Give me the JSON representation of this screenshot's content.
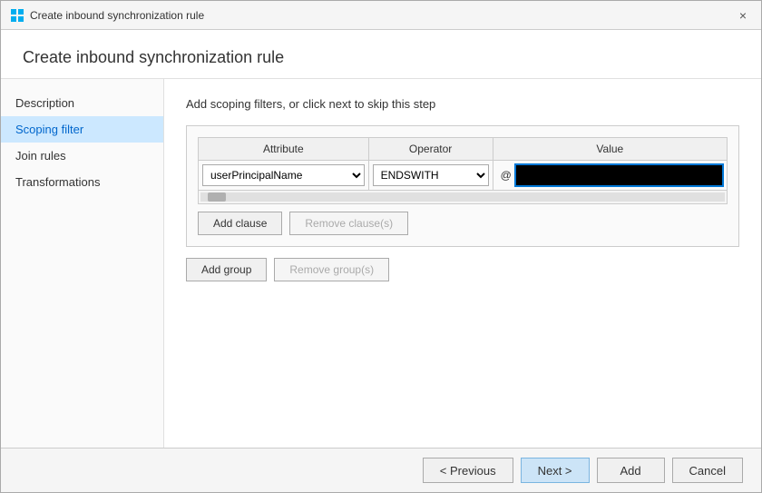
{
  "window": {
    "title": "Create inbound synchronization rule",
    "close_label": "×"
  },
  "page_title": "Create inbound synchronization rule",
  "content": {
    "description": "Add scoping filters, or click next to skip this step"
  },
  "sidebar": {
    "items": [
      {
        "id": "description",
        "label": "Description",
        "active": false
      },
      {
        "id": "scoping-filter",
        "label": "Scoping filter",
        "active": true
      },
      {
        "id": "join-rules",
        "label": "Join rules",
        "active": false
      },
      {
        "id": "transformations",
        "label": "Transformations",
        "active": false
      }
    ]
  },
  "filter_table": {
    "columns": [
      "Attribute",
      "Operator",
      "Value"
    ],
    "row": {
      "attribute": "userPrincipalName",
      "operator": "ENDSWITH",
      "value_prefix": "@",
      "value_redacted": true
    }
  },
  "buttons": {
    "add_clause": "Add clause",
    "remove_clause": "Remove clause(s)",
    "add_group": "Add group",
    "remove_group": "Remove group(s)"
  },
  "footer": {
    "previous": "< Previous",
    "next": "Next >",
    "add": "Add",
    "cancel": "Cancel"
  }
}
